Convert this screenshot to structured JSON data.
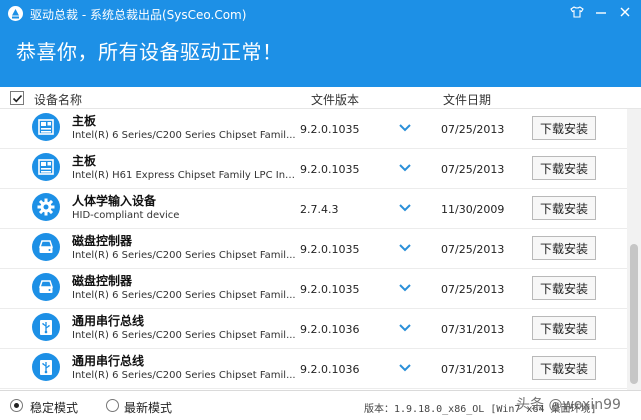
{
  "window": {
    "title": "驱动总裁 - 系统总裁出品(SysCeo.Com)",
    "headline": "恭喜你，所有设备驱动正常！"
  },
  "columns": {
    "name": "设备名称",
    "version": "文件版本",
    "date": "文件日期"
  },
  "drivers": [
    {
      "name": "主板",
      "desc": "Intel(R) 6 Series/C200 Series Chipset Famil...",
      "version": "9.2.0.1035",
      "date": "07/25/2013",
      "action": "下载安装",
      "icon": "motherboard-icon"
    },
    {
      "name": "主板",
      "desc": "Intel(R) H61 Express Chipset Family LPC Int...",
      "version": "9.2.0.1035",
      "date": "07/25/2013",
      "action": "下载安装",
      "icon": "motherboard-icon"
    },
    {
      "name": "人体学输入设备",
      "desc": "HID-compliant device",
      "version": "2.7.4.3",
      "date": "11/30/2009",
      "action": "下载安装",
      "icon": "gear-icon"
    },
    {
      "name": "磁盘控制器",
      "desc": "Intel(R) 6 Series/C200 Series Chipset Famil...",
      "version": "9.2.0.1035",
      "date": "07/25/2013",
      "action": "下载安装",
      "icon": "disk-icon"
    },
    {
      "name": "磁盘控制器",
      "desc": "Intel(R) 6 Series/C200 Series Chipset Famil...",
      "version": "9.2.0.1035",
      "date": "07/25/2013",
      "action": "下载安装",
      "icon": "disk-icon"
    },
    {
      "name": "通用串行总线",
      "desc": "Intel(R) 6 Series/C200 Series Chipset Famil...",
      "version": "9.2.0.1036",
      "date": "07/31/2013",
      "action": "下载安装",
      "icon": "usb-icon"
    },
    {
      "name": "通用串行总线",
      "desc": "Intel(R) 6 Series/C200 Series Chipset Famil...",
      "version": "9.2.0.1036",
      "date": "07/31/2013",
      "action": "下载安装",
      "icon": "usb-icon"
    }
  ],
  "footer": {
    "mode_stable": "稳定模式",
    "mode_latest": "最新模式",
    "selected_mode": "stable",
    "version_info": "版本：1.9.18.0_x86_OL [Win7 x64 桌面环境]",
    "watermark": "头条 @woxin99"
  },
  "colors": {
    "header_bg": "#1d90e6",
    "icon_blue": "#1d90e6",
    "chevron": "#2a8fd8"
  }
}
